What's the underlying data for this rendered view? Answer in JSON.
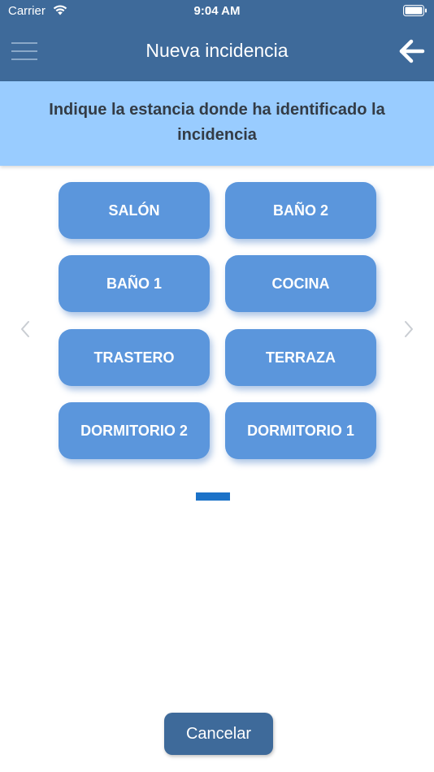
{
  "status_bar": {
    "carrier": "Carrier",
    "time": "9:04 AM"
  },
  "header": {
    "title": "Nueva incidencia",
    "menu_icon": "hamburger-menu-icon",
    "back_icon": "arrow-left-icon"
  },
  "prompt": {
    "text": "Indique la estancia donde ha identificado la incidencia"
  },
  "rooms": [
    {
      "label": "SALÓN"
    },
    {
      "label": "BAÑO 2"
    },
    {
      "label": "BAÑO 1"
    },
    {
      "label": "COCINA"
    },
    {
      "label": "TRASTERO"
    },
    {
      "label": "TERRAZA"
    },
    {
      "label": "DORMITORIO 2"
    },
    {
      "label": "DORMITORIO 1"
    }
  ],
  "pager": {
    "current_page": 1,
    "total_pages": 1
  },
  "actions": {
    "cancel_label": "Cancelar"
  },
  "colors": {
    "header": "#3e6a9a",
    "banner": "#99ccff",
    "room_button": "#5b96dc",
    "page_indicator": "#1c72c8"
  }
}
